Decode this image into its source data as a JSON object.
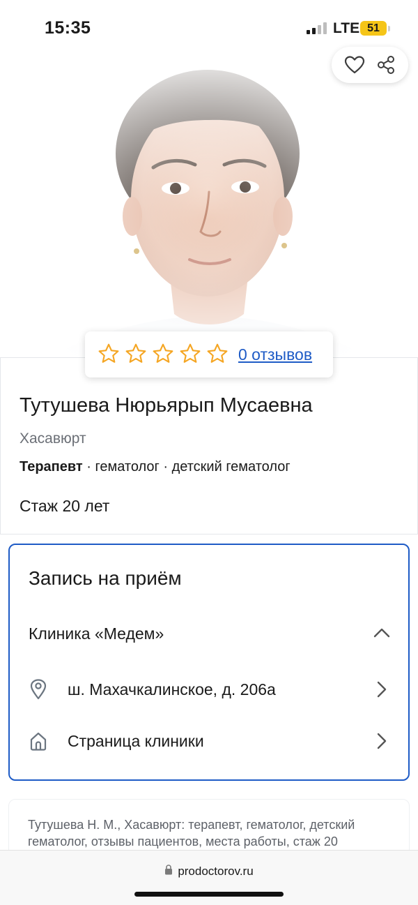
{
  "status_bar": {
    "time": "15:35",
    "network": "LTE",
    "battery": "51"
  },
  "profile": {
    "rating": {
      "stars_filled": 0,
      "stars_total": 5,
      "reviews_label": "0 отзывов"
    },
    "name": "Тутушева Нюрьярып Мусаевна",
    "city": "Хасавюрт",
    "main_specialty": "Терапевт",
    "other_specialties": " · гематолог · детский гематолог",
    "experience": "Стаж 20 лет"
  },
  "appointment": {
    "title": "Запись на приём",
    "clinic_name": "Клиника «Медем»",
    "address": "ш. Махачкалинское, д. 206а",
    "clinic_page_label": "Страница клиники"
  },
  "seo": {
    "text": "Тутушева Н. М., Хасавюрт: терапевт, гематолог, детский гематолог, отзывы пациентов, места работы, стаж 20"
  },
  "browser": {
    "url": "prodoctorov.ru"
  },
  "icons": {
    "favorite": "heart-icon",
    "share": "share-icon",
    "star": "star-outline-icon",
    "location": "location-pin-icon",
    "clinic": "house-icon",
    "collapse": "chevron-up-icon",
    "forward": "chevron-right-icon",
    "lock": "lock-icon"
  },
  "colors": {
    "accent": "#1e5bc6",
    "star": "#f5a623",
    "battery": "#f5c518"
  }
}
